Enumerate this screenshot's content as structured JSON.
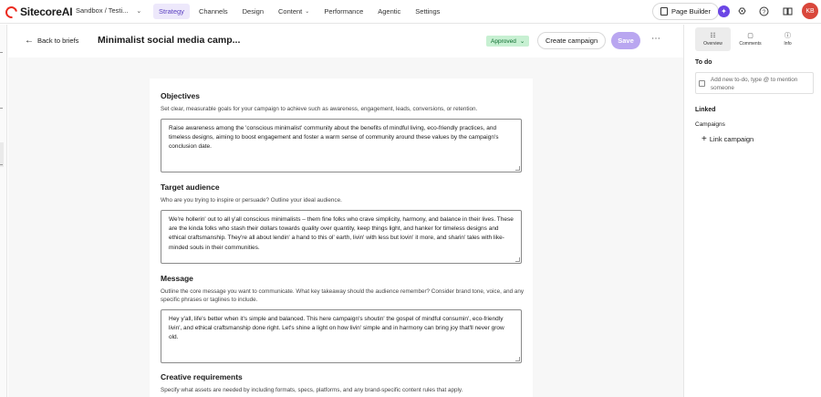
{
  "app": {
    "logo_text": "SitecoreAI",
    "environment": "Sandbox / Testi...",
    "nav": [
      {
        "label": "Strategy",
        "active": true
      },
      {
        "label": "Channels"
      },
      {
        "label": "Design"
      },
      {
        "label": "Content"
      },
      {
        "label": "Performance"
      },
      {
        "label": "Agentic"
      },
      {
        "label": "Settings"
      }
    ],
    "page_builder_label": "Page Builder",
    "avatar_initials": "KB"
  },
  "brief": {
    "back_label": "Back to briefs",
    "title": "Minimalist social media camp...",
    "status": "Approved",
    "create_campaign_label": "Create campaign",
    "save_label": "Save"
  },
  "sections": {
    "objectives": {
      "title": "Objectives",
      "help": "Set clear, measurable goals for your campaign to achieve such as awareness, engagement, leads, conversions, or retention.",
      "value": "Raise awareness among the 'conscious minimalist' community about the benefits of mindful living, eco-friendly practices, and timeless designs, aiming to boost engagement and foster a warm sense of community around these values by the campaign's conclusion date."
    },
    "audience": {
      "title": "Target audience",
      "help": "Who are you trying to inspire or persuade? Outline your ideal audience.",
      "value": "We're hollerin' out to all y'all conscious minimalists – them fine folks who crave simplicity, harmony, and balance in their lives. These are the kinda folks who stash their dollars towards quality over quantity, keep things light, and hanker for timeless designs and ethical craftsmanship. They're all about lendin' a hand to this ol' earth, livin' with less but lovin' it more, and sharin' tales with like-minded souls in their communities."
    },
    "message": {
      "title": "Message",
      "help": "Outline the core message you want to communicate. What key takeaway should the audience remember? Consider brand tone, voice, and any specific phrases or taglines to include.",
      "value": "Hey y'all, life's better when it's simple and balanced. This here campaign's shoutin' the gospel of mindful consumin', eco-friendly livin', and ethical craftsmanship done right. Let's shine a light on how livin' simple and in harmony can bring joy that'll never grow old."
    },
    "creative": {
      "title": "Creative requirements",
      "help": "Specify what assets are needed by including formats, specs, platforms, and any brand-specific content rules that apply."
    }
  },
  "panel": {
    "tabs": [
      {
        "label": "Overview",
        "icon": "overview-icon",
        "active": true
      },
      {
        "label": "Comments",
        "icon": "comments-icon"
      },
      {
        "label": "Info",
        "icon": "info-icon"
      }
    ],
    "todo_title": "To do",
    "todo_placeholder": "Add new to-do, type @ to mention someone",
    "linked_title": "Linked",
    "campaigns_label": "Campaigns",
    "link_campaign_label": "Link campaign"
  },
  "colors": {
    "accent": "#6b46e5",
    "nav_active_bg": "#ede8fb",
    "status_bg": "#c7f0d2",
    "save_bg": "#b9a6f0",
    "avatar_bg": "#d9473b"
  }
}
